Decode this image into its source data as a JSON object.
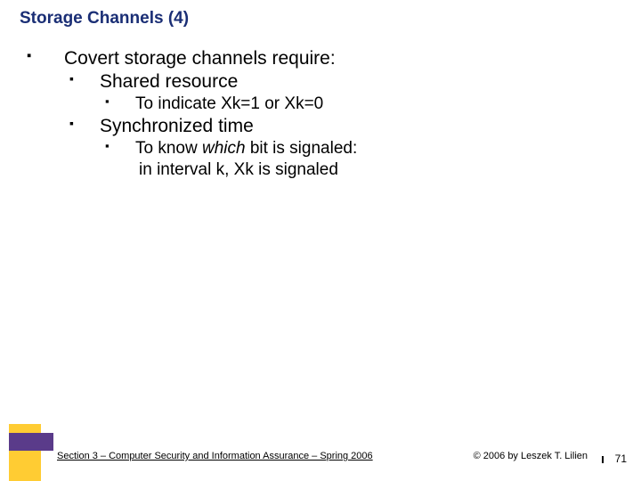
{
  "title": "Storage Channels (4)",
  "lines": {
    "l1": "Covert storage channels require:",
    "l2": "Shared resource",
    "l3": "To indicate Xk=1 or Xk=0",
    "l4": "Synchronized time",
    "l5a": "To know ",
    "l5b": "which",
    "l5c": " bit is signaled:",
    "l6": "in interval k, Xk is signaled"
  },
  "footer": {
    "left": "Section 3 – Computer Security and Information Assurance – Spring 2006",
    "right": "© 2006 by Leszek T. Lilien",
    "page": "71"
  }
}
